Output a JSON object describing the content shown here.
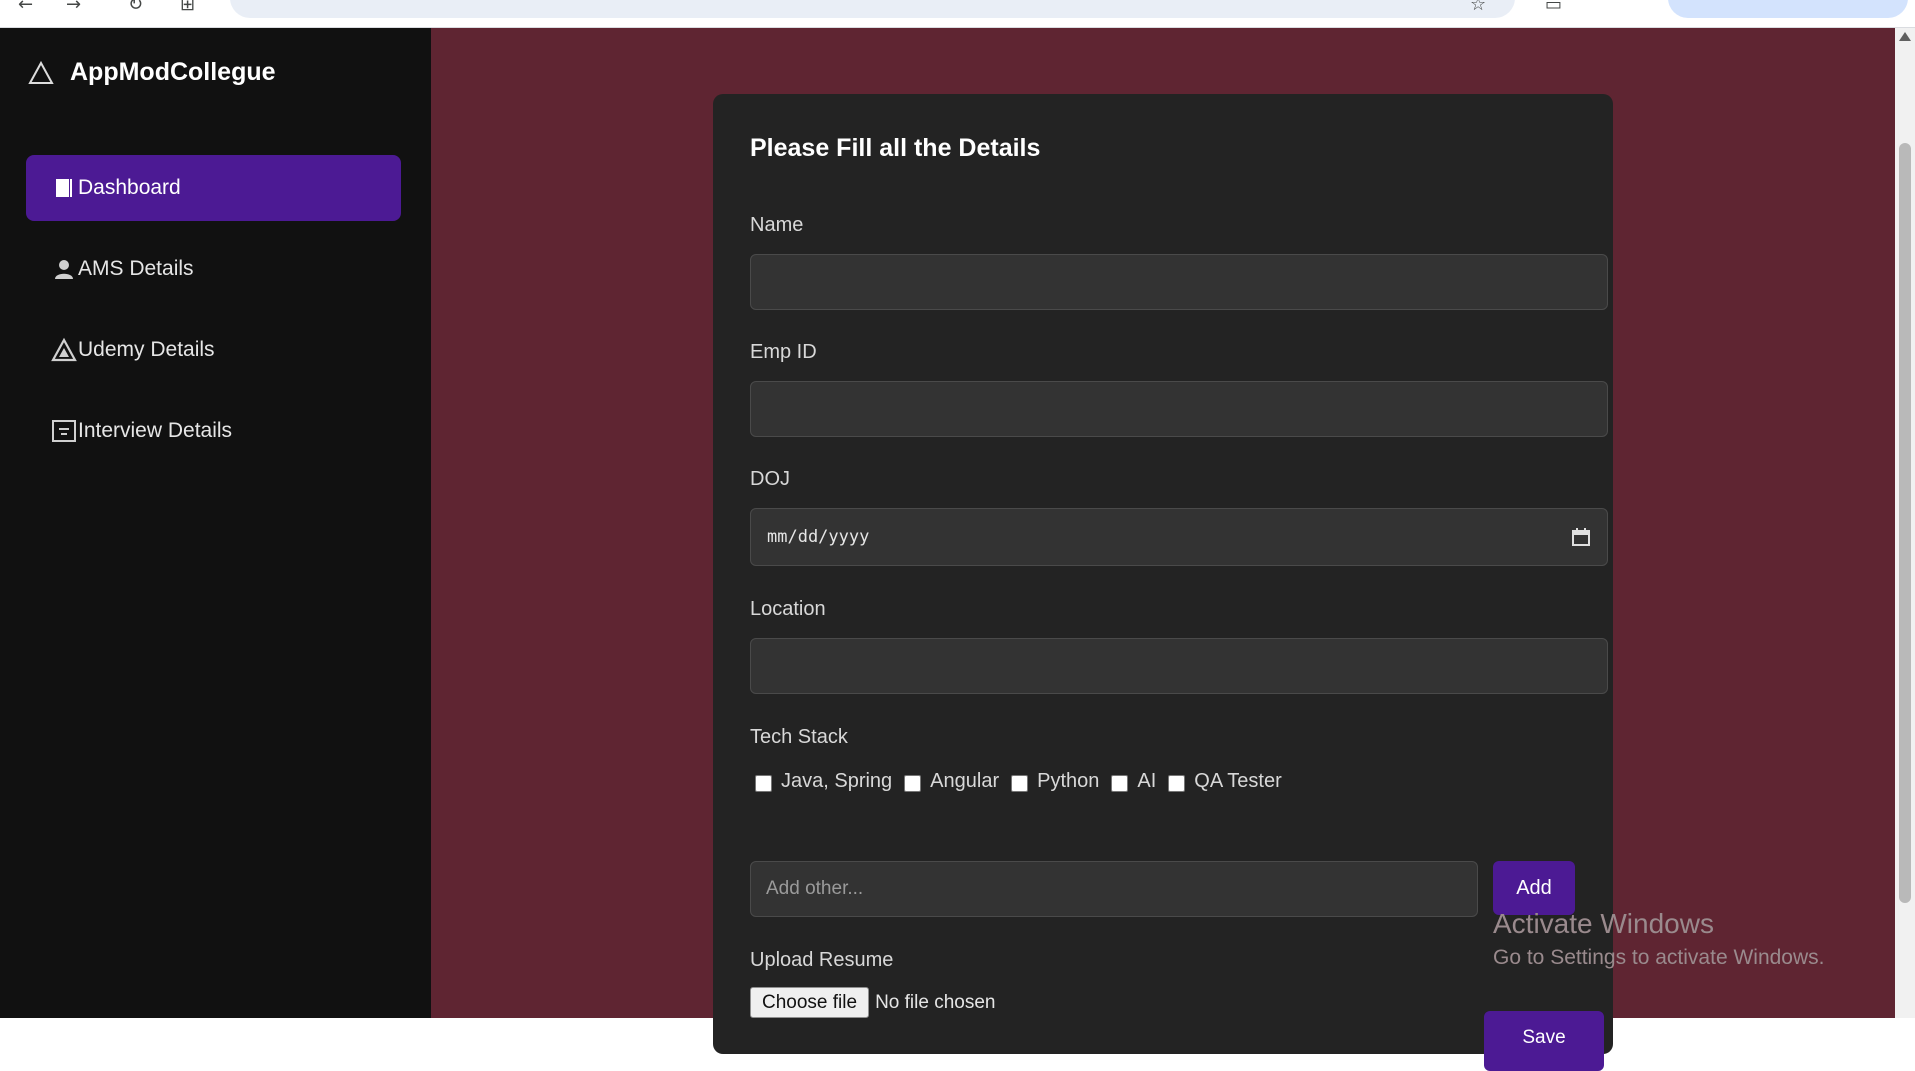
{
  "app": {
    "brand": "AppModCollegue",
    "accent_color": "#4c1a94",
    "main_background": "#5f2532",
    "sidebar_background": "#111111"
  },
  "sidebar": {
    "items": [
      {
        "label": "Dashboard",
        "icon": "book-icon",
        "active": true
      },
      {
        "label": "AMS Details",
        "icon": "person-icon",
        "active": false
      },
      {
        "label": "Udemy Details",
        "icon": "udemy-icon",
        "active": false
      },
      {
        "label": "Interview Details",
        "icon": "interview-list-icon",
        "active": false
      }
    ]
  },
  "form": {
    "title": "Please Fill all the Details",
    "name_label": "Name",
    "name_value": "",
    "empid_label": "Emp ID",
    "empid_value": "",
    "doj_label": "DOJ",
    "doj_placeholder": "mm/dd/yyyy",
    "location_label": "Location",
    "location_value": "",
    "tech_label": "Tech Stack",
    "tech_options": [
      {
        "label": "Java, Spring",
        "checked": false
      },
      {
        "label": "Angular",
        "checked": false
      },
      {
        "label": "Python",
        "checked": false
      },
      {
        "label": "AI",
        "checked": false
      },
      {
        "label": "QA Tester",
        "checked": false
      }
    ],
    "other_placeholder": "Add other...",
    "add_label": "Add",
    "upload_label": "Upload Resume",
    "choose_file_label": "Choose file",
    "file_status": "No file chosen",
    "save_label": "Save"
  },
  "watermark": {
    "title": "Activate Windows",
    "subtitle": "Go to Settings to activate Windows."
  }
}
